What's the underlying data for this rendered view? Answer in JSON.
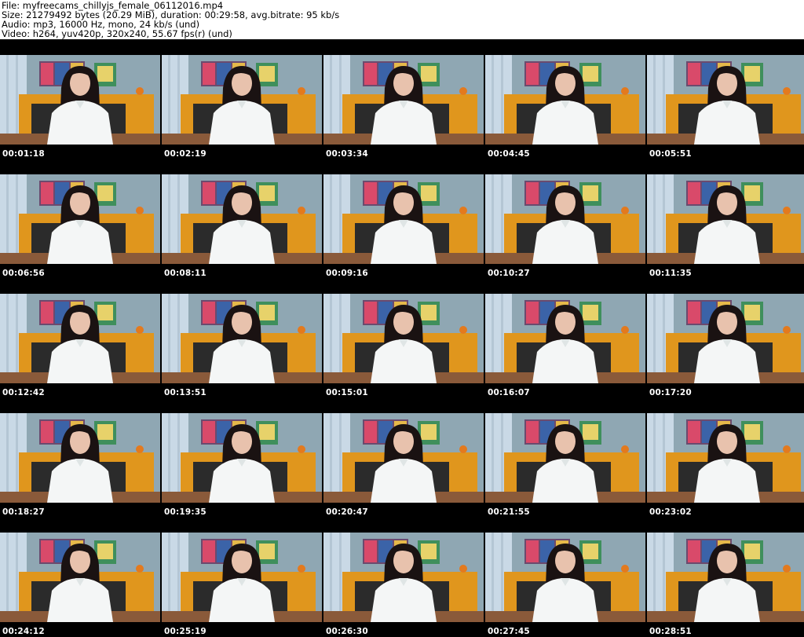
{
  "header": {
    "file_line": "File: myfreecams_chillyjs_female_06112016.mp4",
    "size_line": "Size: 21279492 bytes (20.29 MiB), duration: 00:29:58, avg.bitrate: 95 kb/s",
    "audio_line": "Audio: mp3, 16000 Hz, mono, 24 kb/s (und)",
    "video_line": "Video: h264, yuv420p, 320x240, 55.67 fps(r) (und)"
  },
  "grid": {
    "columns": 5,
    "rows": 5
  },
  "thumbnails": [
    {
      "timestamp": "00:01:18"
    },
    {
      "timestamp": "00:02:19"
    },
    {
      "timestamp": "00:03:34"
    },
    {
      "timestamp": "00:04:45"
    },
    {
      "timestamp": "00:05:51"
    },
    {
      "timestamp": "00:06:56"
    },
    {
      "timestamp": "00:08:11"
    },
    {
      "timestamp": "00:09:16"
    },
    {
      "timestamp": "00:10:27"
    },
    {
      "timestamp": "00:11:35"
    },
    {
      "timestamp": "00:12:42"
    },
    {
      "timestamp": "00:13:51"
    },
    {
      "timestamp": "00:15:01"
    },
    {
      "timestamp": "00:16:07"
    },
    {
      "timestamp": "00:17:20"
    },
    {
      "timestamp": "00:18:27"
    },
    {
      "timestamp": "00:19:35"
    },
    {
      "timestamp": "00:20:47"
    },
    {
      "timestamp": "00:21:55"
    },
    {
      "timestamp": "00:23:02"
    },
    {
      "timestamp": "00:24:12"
    },
    {
      "timestamp": "00:25:19"
    },
    {
      "timestamp": "00:26:30"
    },
    {
      "timestamp": "00:27:45"
    },
    {
      "timestamp": "00:28:51"
    }
  ],
  "colors": {
    "sheet_background": "#000000",
    "header_background": "#ffffff",
    "wall": "#8fa7b3",
    "curtain": "#c9d9e6",
    "sofa": "#e0961d",
    "sofa_dark": "#2b2b2b",
    "shirt": "#f4f6f6",
    "hair": "#1a1212",
    "skin": "#e8c2ad",
    "floor": "#8a5a3a"
  }
}
